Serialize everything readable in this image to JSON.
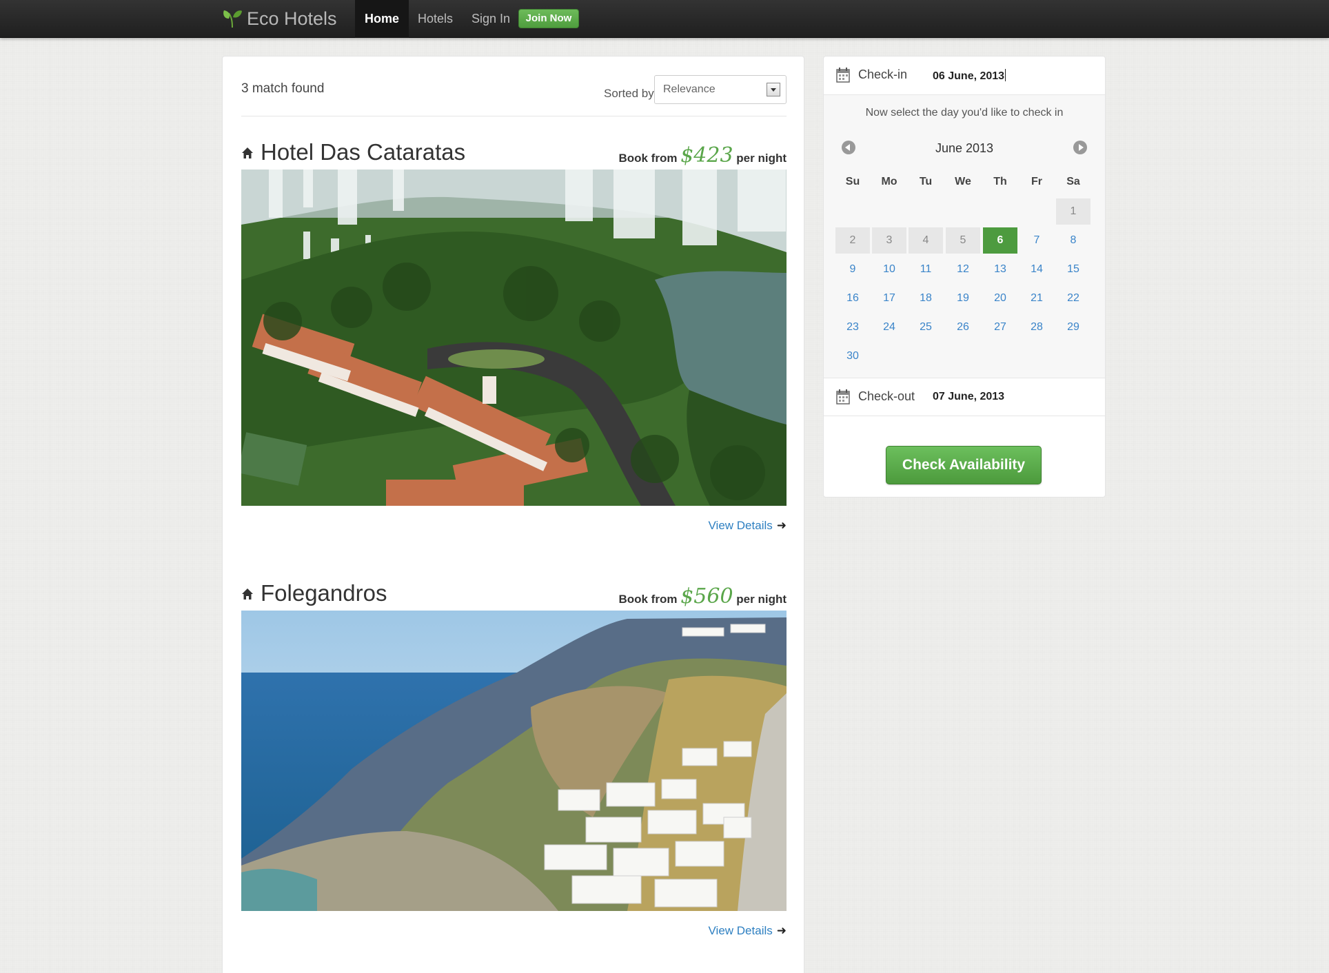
{
  "nav": {
    "brand": "Eco Hotels",
    "items": [
      {
        "label": "Home",
        "active": true
      },
      {
        "label": "Hotels",
        "active": false
      },
      {
        "label": "Sign In",
        "active": false
      }
    ],
    "join_label": "Join Now"
  },
  "results": {
    "count_text": "3 match found",
    "sort_label": "Sorted by",
    "sort_value": "Relevance",
    "hotels": [
      {
        "name": "Hotel Das Cataratas",
        "book_from": "Book from",
        "price": "$423",
        "per_night": "per night",
        "view_details": "View Details",
        "image": "aerial photo of hotel beside waterfalls and forest"
      },
      {
        "name": "Folegandros",
        "book_from": "Book from",
        "price": "$560",
        "per_night": "per night",
        "view_details": "View Details",
        "image": "white cycladic village on cliff above blue sea"
      }
    ]
  },
  "booking": {
    "checkin_label": "Check-in",
    "checkin_value": "06 June, 2013",
    "hint": "Now select the day you'd like to check in",
    "month_title": "June 2013",
    "weekdays": [
      "Su",
      "Mo",
      "Tu",
      "We",
      "Th",
      "Fr",
      "Sa"
    ],
    "days": [
      "1",
      "2",
      "3",
      "4",
      "5",
      "6",
      "7",
      "8",
      "9",
      "10",
      "11",
      "12",
      "13",
      "14",
      "15",
      "16",
      "17",
      "18",
      "19",
      "20",
      "21",
      "22",
      "23",
      "24",
      "25",
      "26",
      "27",
      "28",
      "29",
      "30"
    ],
    "selected_day": "6",
    "disabled_days": [
      "1",
      "2",
      "3",
      "4",
      "5"
    ],
    "checkout_label": "Check-out",
    "checkout_value": "07 June, 2013",
    "check_button": "Check Availability"
  },
  "colors": {
    "accent_green": "#4d9b3f",
    "price_green": "#5aa64a",
    "link_blue": "#2d7fc1"
  }
}
